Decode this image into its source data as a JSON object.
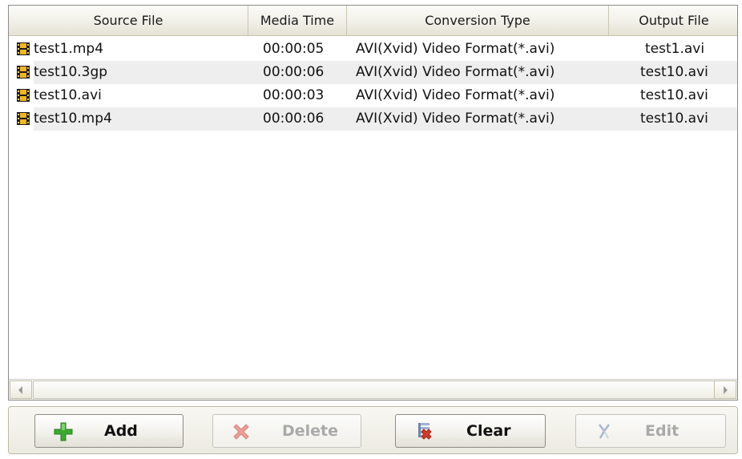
{
  "columns": {
    "source_file": "Source File",
    "media_time": "Media Time",
    "conversion_type": "Conversion Type",
    "output_file": "Output File"
  },
  "rows": [
    {
      "source_file": "test1.mp4",
      "media_time": "00:00:05",
      "conversion_type": "AVI(Xvid) Video Format(*.avi)",
      "output_file": "test1.avi",
      "icon": "film-icon"
    },
    {
      "source_file": "test10.3gp",
      "media_time": "00:00:06",
      "conversion_type": "AVI(Xvid) Video Format(*.avi)",
      "output_file": "test10.avi",
      "icon": "film-icon"
    },
    {
      "source_file": "test10.avi",
      "media_time": "00:00:03",
      "conversion_type": "AVI(Xvid) Video Format(*.avi)",
      "output_file": "test10.avi",
      "icon": "film-icon"
    },
    {
      "source_file": "test10.mp4",
      "media_time": "00:00:06",
      "conversion_type": "AVI(Xvid) Video Format(*.avi)",
      "output_file": "test10.avi",
      "icon": "film-icon"
    }
  ],
  "toolbar": {
    "add_label": "Add",
    "delete_label": "Delete",
    "clear_label": "Clear",
    "edit_label": "Edit",
    "add_icon": "plus-icon",
    "delete_icon": "delete-x-icon",
    "clear_icon": "clear-list-icon",
    "edit_icon": "edit-scissors-icon",
    "delete_enabled": false,
    "edit_enabled": false
  },
  "colors": {
    "row_alt": "#eeeeee",
    "add_green": "#3daa2f",
    "delete_disabled": "#e7a09a",
    "clear_red": "#d23c2c",
    "header_bg": "#f1f0e8",
    "toolbar_bg": "#ecebe2"
  }
}
